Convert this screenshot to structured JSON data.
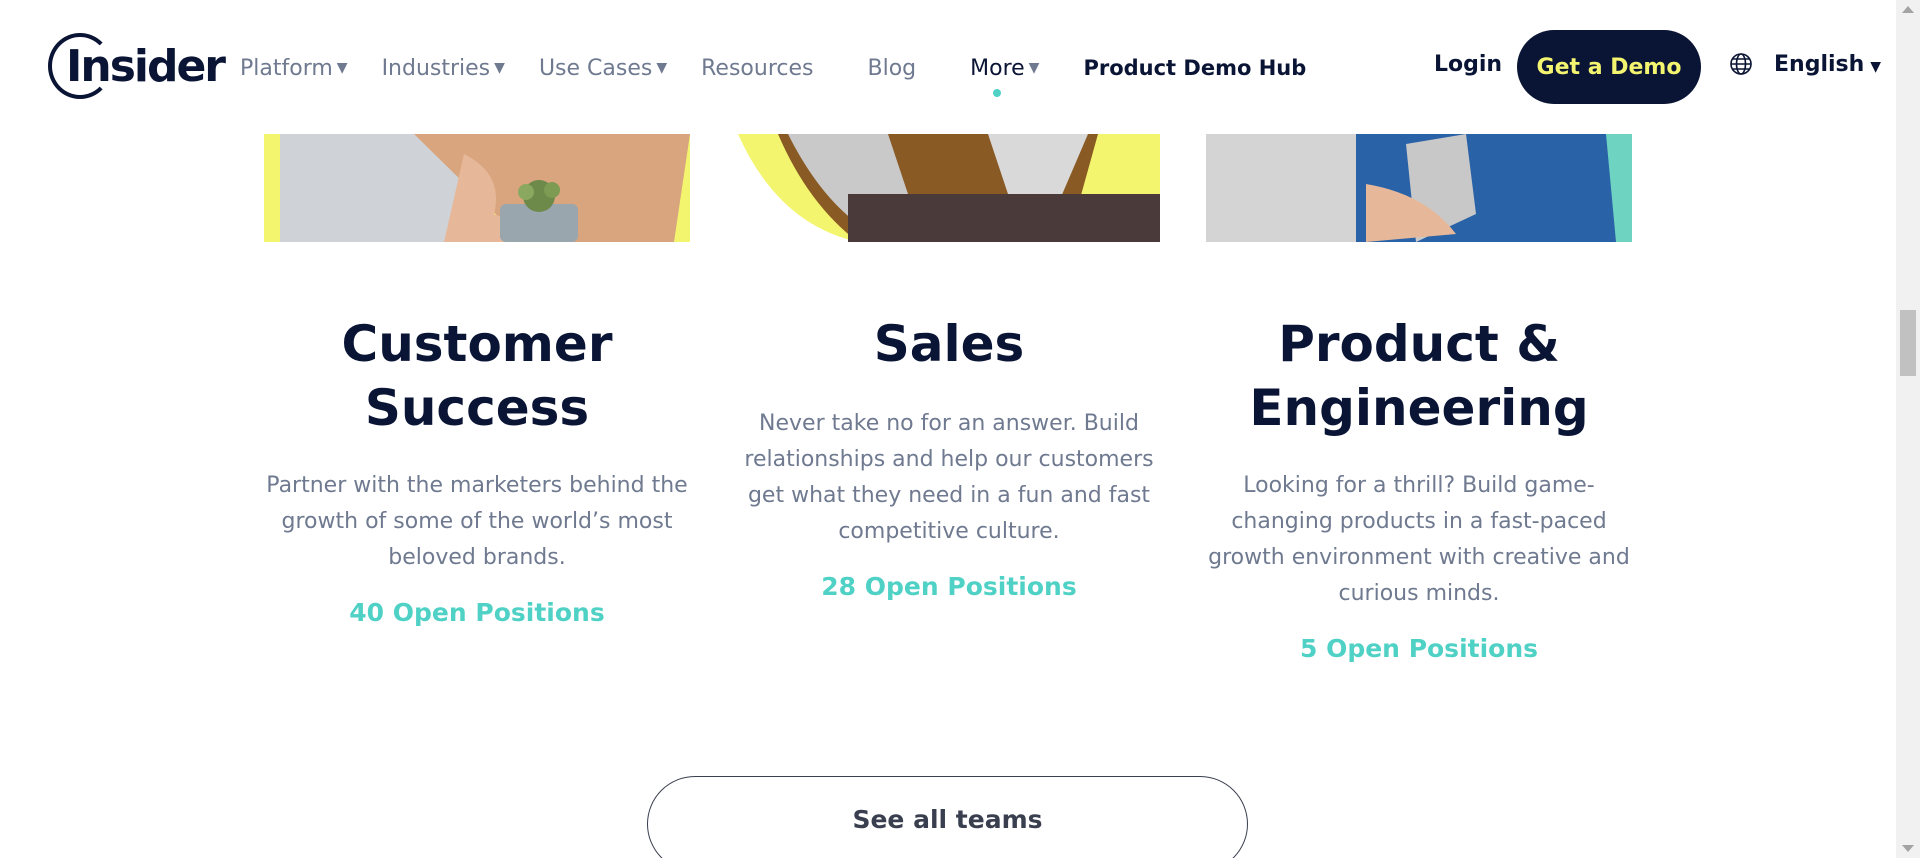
{
  "header": {
    "logo_text": "Insider",
    "nav": [
      {
        "label": "Platform",
        "caret": "▼"
      },
      {
        "label": "Industries",
        "caret": "▼"
      },
      {
        "label": "Use Cases",
        "caret": "▼"
      },
      {
        "label": "Resources",
        "caret": ""
      },
      {
        "label": "Blog",
        "caret": ""
      },
      {
        "label": "More",
        "caret": "▼"
      }
    ],
    "demo_hub": "Product Demo Hub",
    "login": "Login",
    "get_demo": "Get a Demo",
    "language": "English",
    "language_caret": "▼"
  },
  "teams": [
    {
      "title_line1": "Customer",
      "title_line2": "Success",
      "description": "Partner with the marketers behind the growth of some of the world’s most beloved brands.",
      "positions": "40 Open Positions"
    },
    {
      "title_line1": "Sales",
      "title_line2": "",
      "description": "Never take no for an answer. Build relationships and help our customers get what they need in a fun and fast competitive culture.",
      "positions": "28 Open Positions"
    },
    {
      "title_line1": "Product &",
      "title_line2": "Engineering",
      "description": "Looking for a thrill? Build game-changing products in a fast-paced growth environment with creative and curious minds.",
      "positions": "5 Open Positions"
    }
  ],
  "see_all": "See all teams",
  "colors": {
    "navy": "#0a1434",
    "teal": "#4fd1c5",
    "yellow": "#f3f46f",
    "gray_text": "#6f7a90"
  }
}
